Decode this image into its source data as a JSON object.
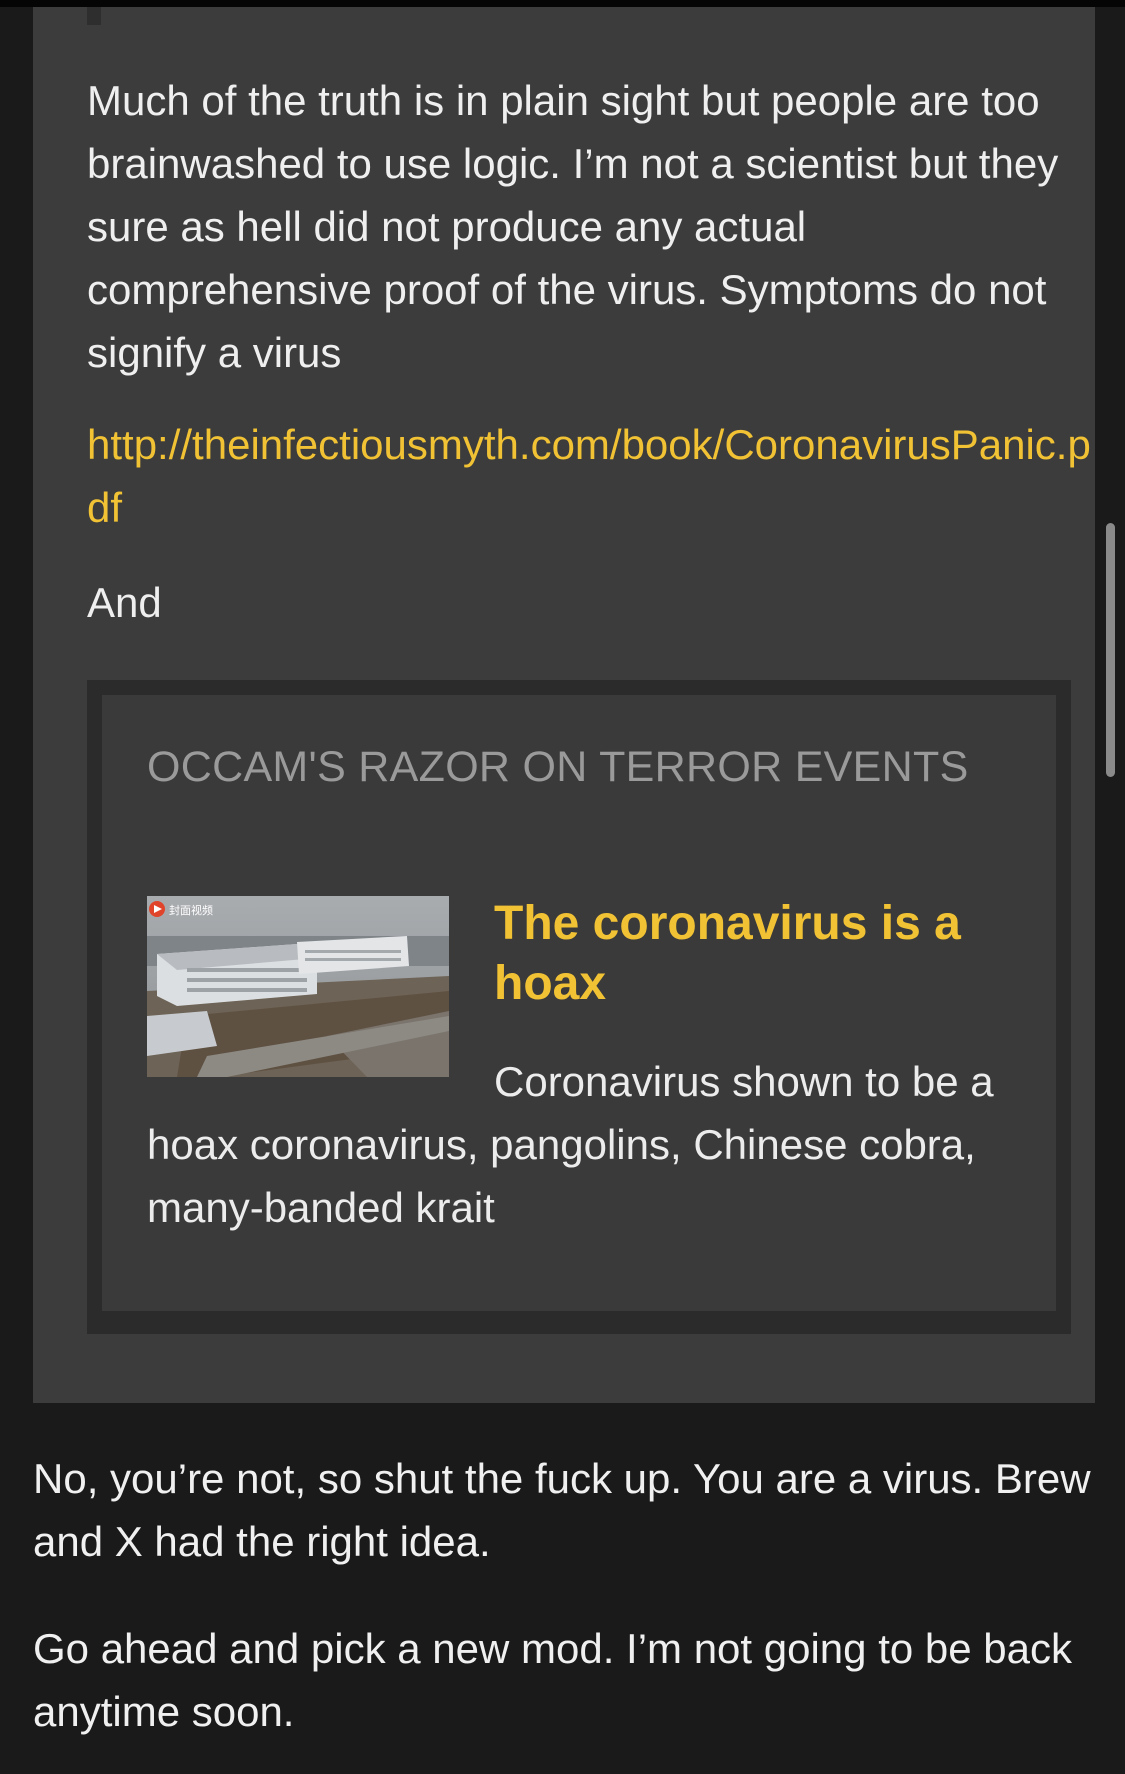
{
  "quoted_post": {
    "paragraph_1": "Much of the truth is in plain sight but people are too brainwashed to use logic. I’m not a scientist but they sure as hell did not produce any actual comprehensive proof of the virus. Symptoms do not signify a virus",
    "link_text": "http://theinfectiousmyth.com/book/CoronavirusPanic.pdf",
    "paragraph_2": "And",
    "embed": {
      "site_name": "OCCAM'S RAZOR ON TERROR EVENTS",
      "title": "The coronavirus is a hoax",
      "description": "Coronavirus shown to be a hoax coronavirus, pangolins, Chinese cobra, many-banded krait",
      "thumbnail_watermark": "封面视频"
    }
  },
  "reply": {
    "paragraph_1": "No, you’re not, so shut the fuck up. You are a virus. Brew and X had the right idea.",
    "paragraph_2": "Go ahead and pick a new mod. I’m not going to be back anytime soon."
  },
  "colors": {
    "page_background": "#1a1a1a",
    "quote_background": "#3c3c3c",
    "link": "#f2c235",
    "embed_title": "#f2c235",
    "text": "#efefef",
    "embed_site_name": "#9a9a9a"
  }
}
